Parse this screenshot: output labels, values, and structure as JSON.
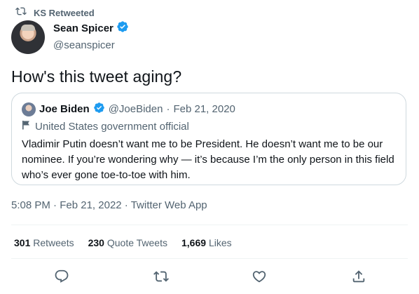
{
  "retweet": {
    "label": "KS Retweeted"
  },
  "author": {
    "display_name": "Sean Spicer",
    "handle": "@seanspicer"
  },
  "tweet": {
    "text": "How's this tweet aging?"
  },
  "quote": {
    "display_name": "Joe Biden",
    "handle": "@JoeBiden",
    "separator": "·",
    "date": "Feb 21, 2020",
    "label": "United States government official",
    "lines": [
      "Vladimir Putin doesn’t want me to be President. He doesn’t want me to be our",
      "nominee. If you’re wondering why — it’s because I’m the only person in this field",
      "who’s ever gone toe-to-toe with him."
    ]
  },
  "timestamp": {
    "time": "5:08 PM",
    "date": "Feb 21, 2022",
    "source": "Twitter Web App",
    "sep": "·"
  },
  "stats": {
    "retweets": {
      "count": "301",
      "label": "Retweets"
    },
    "quotes": {
      "count": "230",
      "label": "Quote Tweets"
    },
    "likes": {
      "count": "1,669",
      "label": "Likes"
    }
  },
  "colors": {
    "verified": "#1d9bf0",
    "muted": "#536471",
    "text": "#0f1419",
    "border": "#cfd9de"
  },
  "icons": [
    "retweet-icon",
    "verified-badge-icon",
    "flag-icon",
    "reply-icon",
    "like-icon",
    "share-icon"
  ]
}
